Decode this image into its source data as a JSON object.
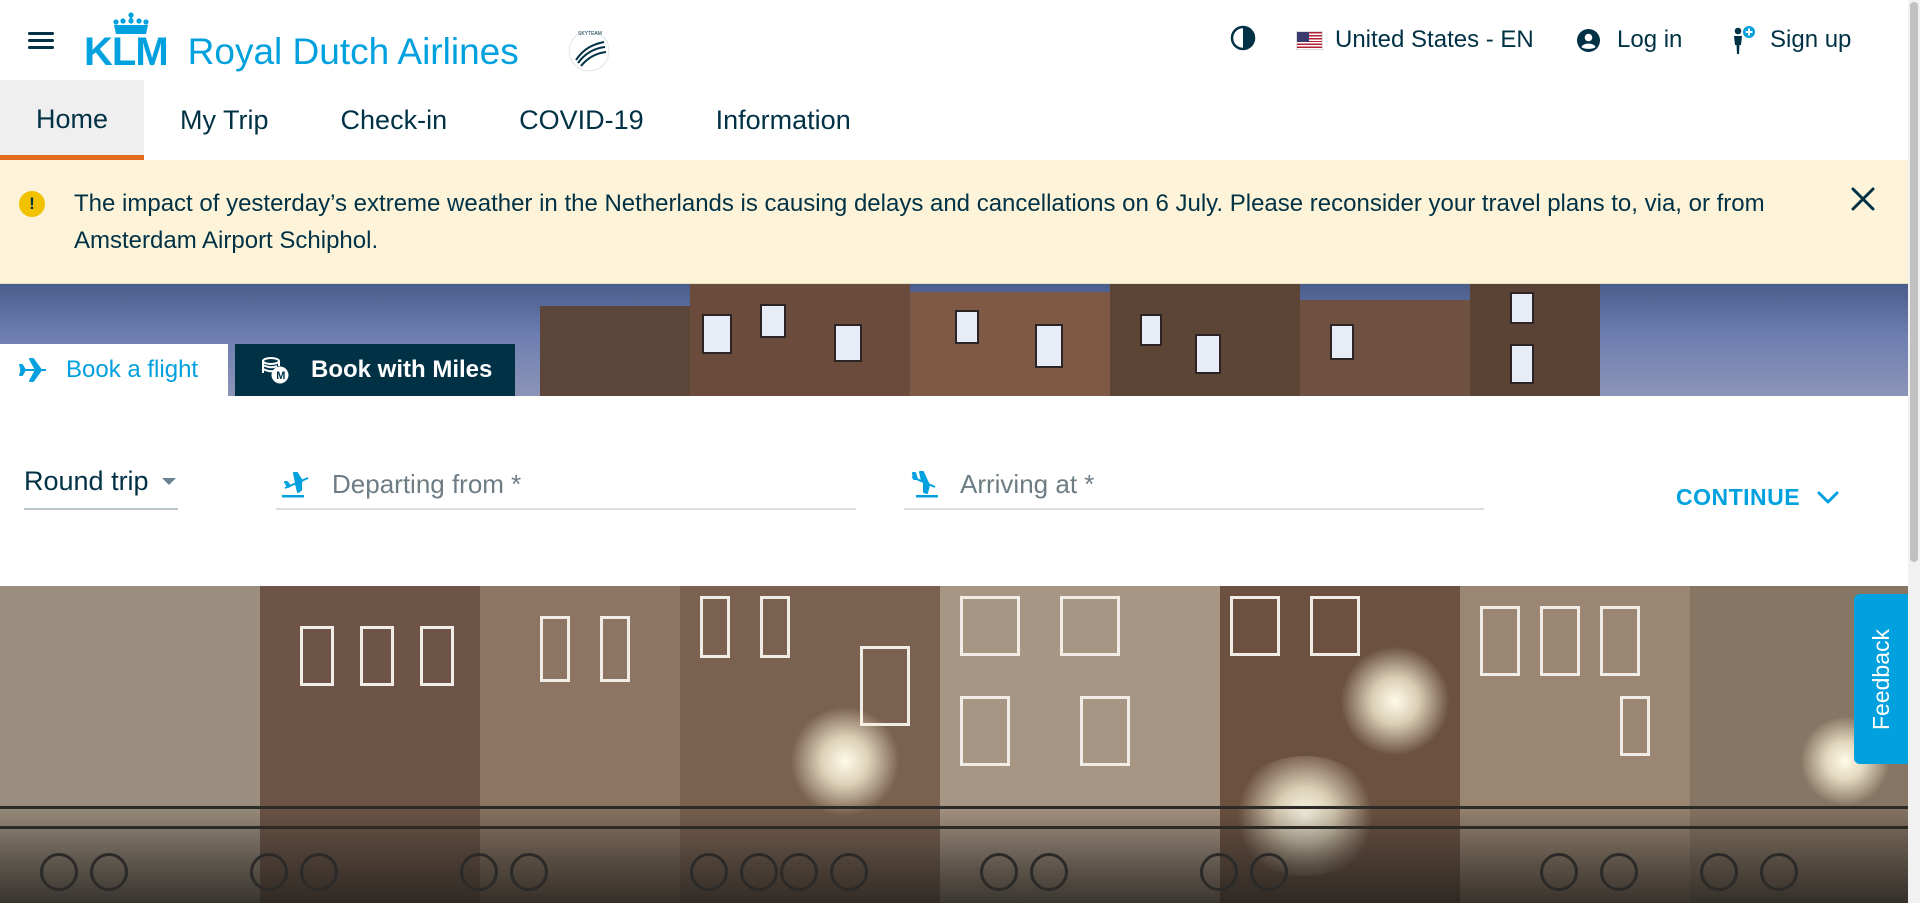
{
  "brand": {
    "logo_text": "KLM",
    "name": "Royal Dutch Airlines",
    "skyteam_text": "SKYTEAM",
    "accent_color": "#00a1de",
    "navy_color": "#003145",
    "active_tab_color": "#e36c1f"
  },
  "header": {
    "country_label": "United States - EN",
    "login_label": "Log in",
    "signup_label": "Sign up"
  },
  "nav": {
    "items": [
      {
        "label": "Home",
        "active": true
      },
      {
        "label": "My Trip"
      },
      {
        "label": "Check-in"
      },
      {
        "label": "COVID-19"
      },
      {
        "label": "Information"
      }
    ]
  },
  "alert": {
    "icon": "!",
    "message": "The impact of yesterday’s extreme weather in the Netherlands is causing delays and cancellations on 6 July. Please reconsider your travel plans to, via, or from Amsterdam Airport Schiphol."
  },
  "booking": {
    "tab_book_flight": "Book a flight",
    "tab_book_miles": "Book with Miles",
    "trip_type": "Round trip",
    "departing_placeholder": "Departing from *",
    "arriving_placeholder": "Arriving at *",
    "continue_label": "CONTINUE"
  },
  "feedback_label": "Feedback"
}
